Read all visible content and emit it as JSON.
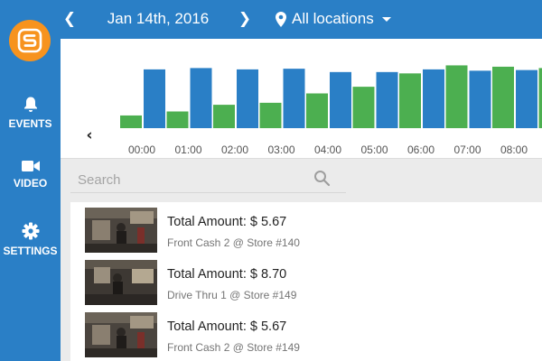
{
  "header": {
    "date": "Jan 14th, 2016",
    "location": "All locations"
  },
  "sidebar": {
    "items": [
      {
        "label": "EVENTS",
        "icon": "bell-icon"
      },
      {
        "label": "VIDEO",
        "icon": "video-camera-icon"
      },
      {
        "label": "SETTINGS",
        "icon": "gear-icon"
      }
    ]
  },
  "colors": {
    "brand_blue": "#2a7fc6",
    "logo_orange": "#f7931e",
    "bar_green": "#4caf50",
    "bar_blue": "#2a7fc6"
  },
  "chart_data": {
    "type": "bar",
    "categories": [
      "00:00",
      "01:00",
      "02:00",
      "03:00",
      "04:00",
      "05:00",
      "06:00",
      "07:00",
      "08:00"
    ],
    "ymax": 100,
    "series": [
      {
        "color": "green",
        "values": [
          19,
          25,
          35,
          38,
          52,
          62,
          82,
          94,
          92
        ]
      },
      {
        "color": "blue",
        "values": [
          88,
          90,
          88,
          89,
          84,
          84,
          88,
          86,
          87
        ]
      }
    ],
    "extra_bar": {
      "color": "green",
      "value": 90
    }
  },
  "search": {
    "placeholder": "Search"
  },
  "events": [
    {
      "amount": "Total Amount: $ 5.67",
      "place": "Front Cash 2 @ Store #140"
    },
    {
      "amount": "Total Amount: $ 8.70",
      "place": "Drive Thru 1 @ Store #149"
    },
    {
      "amount": "Total Amount: $ 5.67",
      "place": "Front Cash 2 @ Store #149"
    }
  ]
}
